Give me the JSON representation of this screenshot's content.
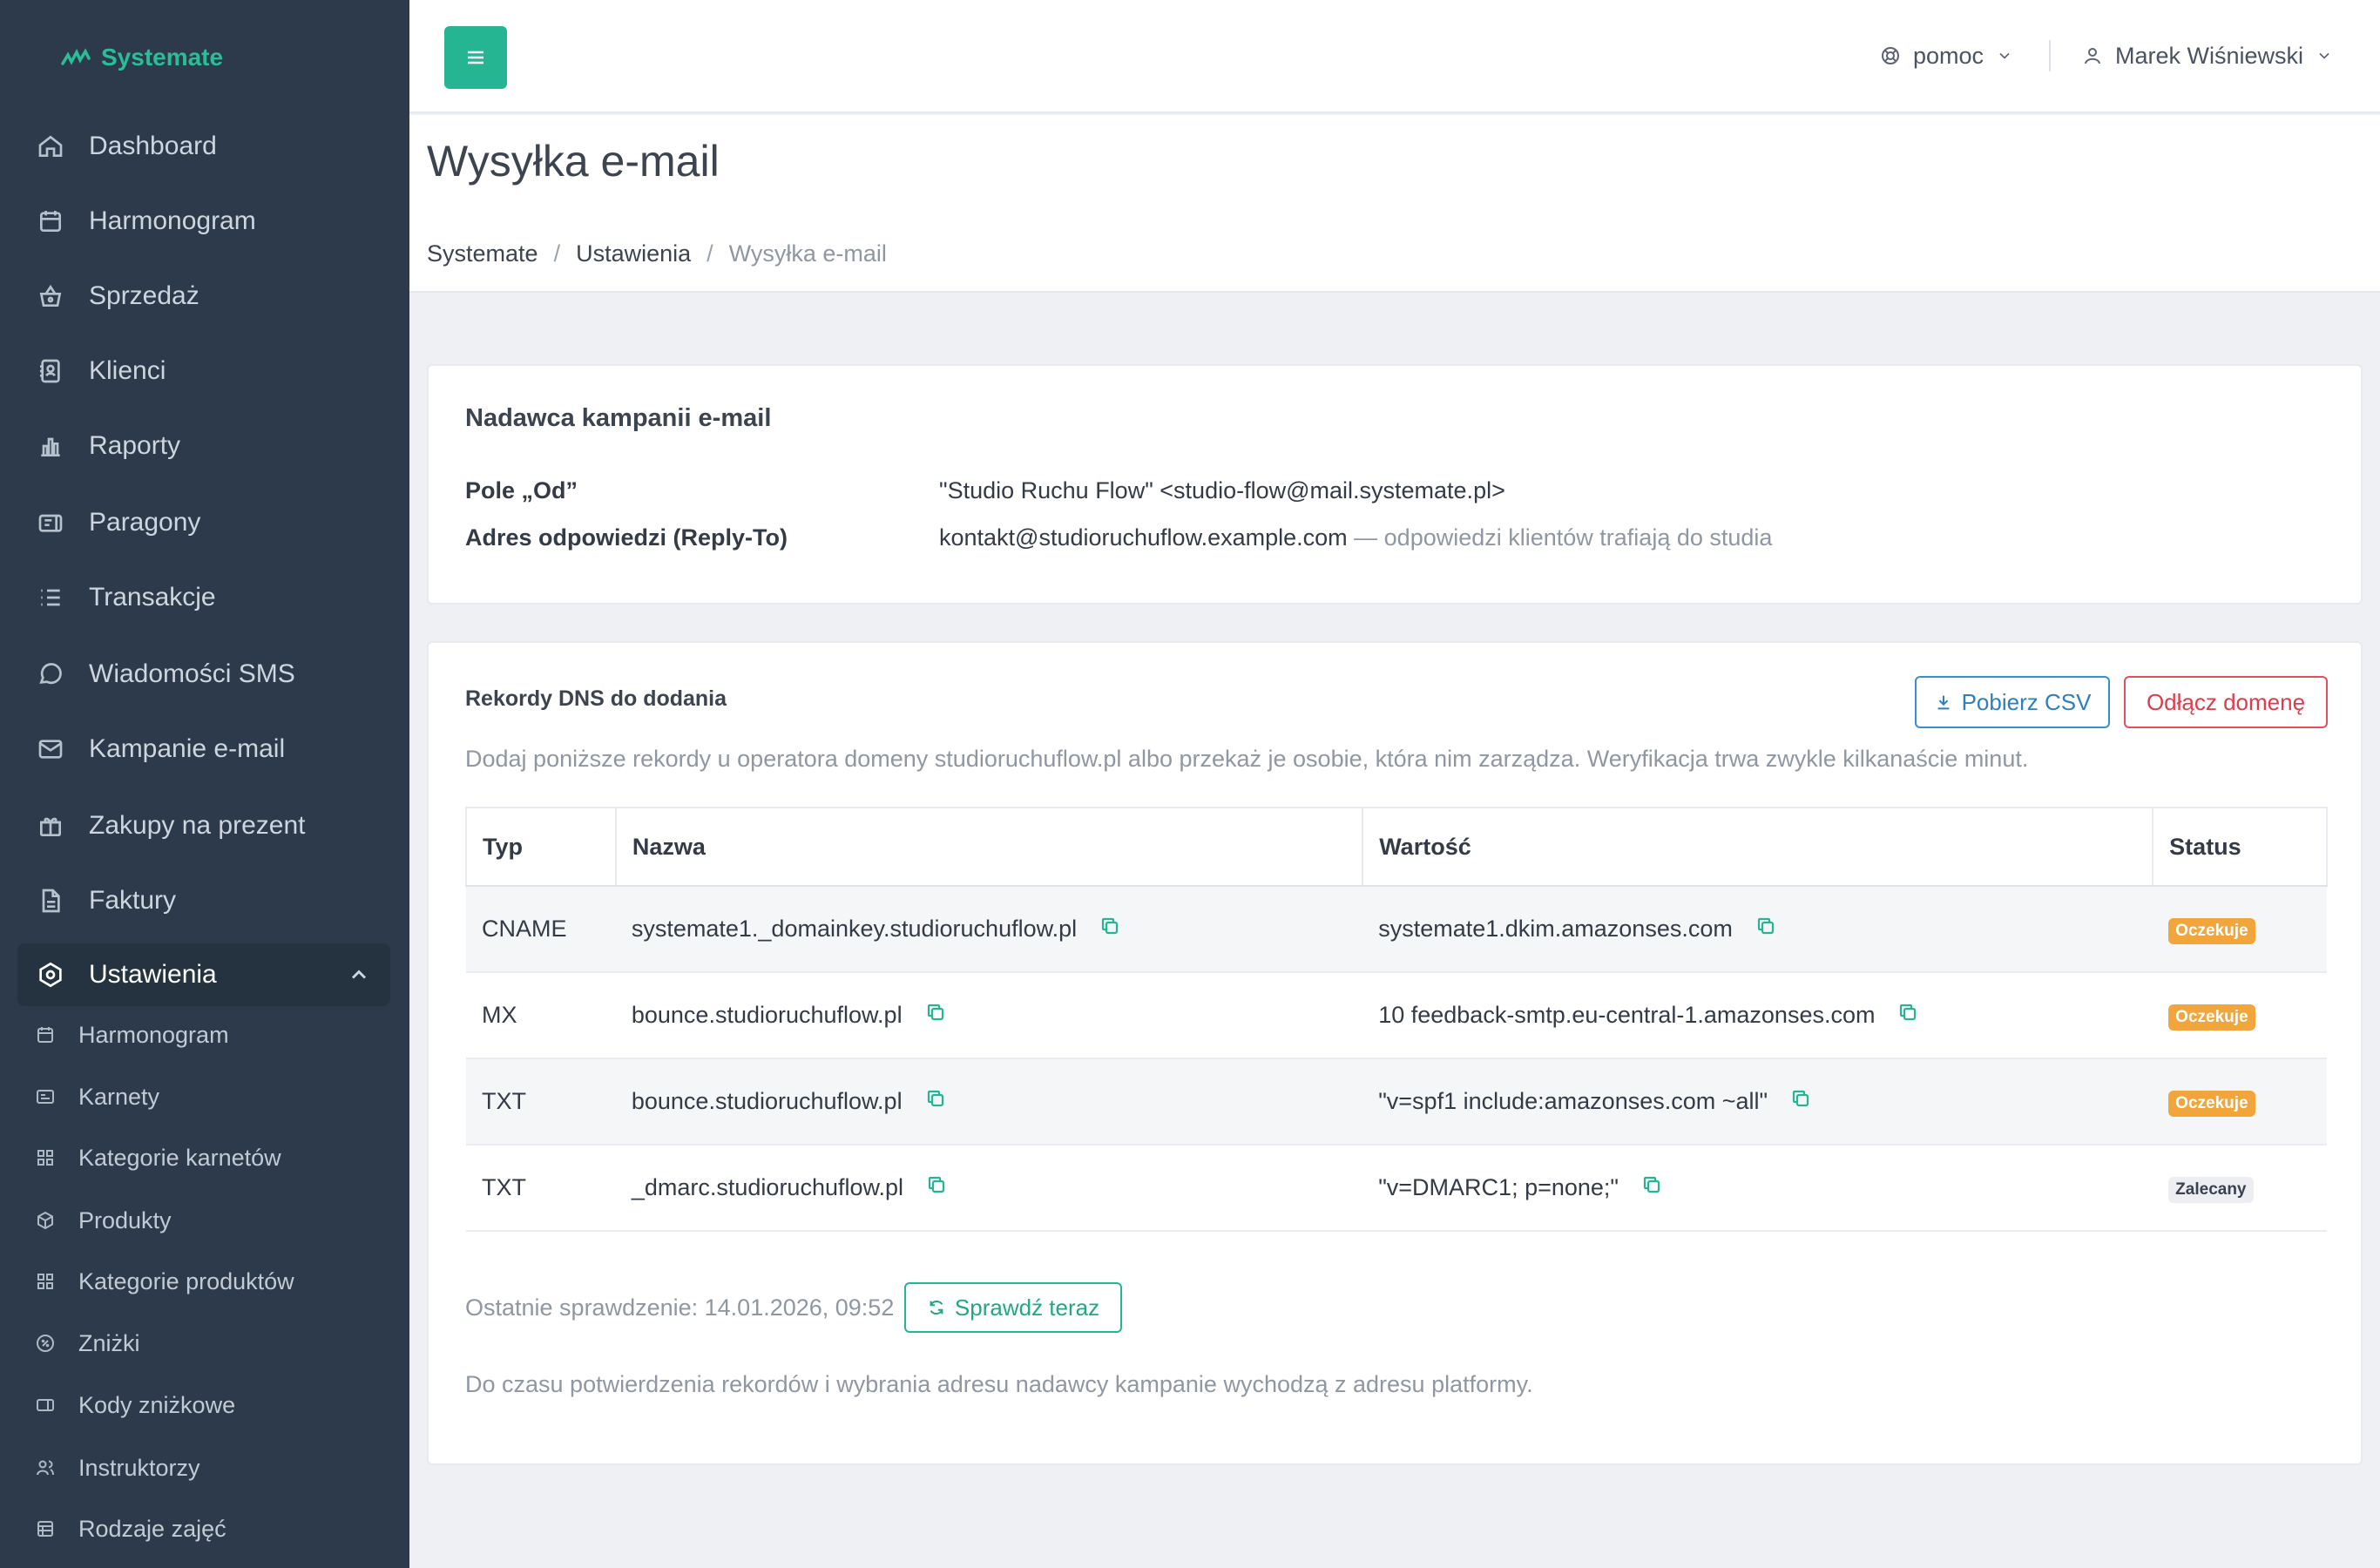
{
  "brand": {
    "name": "Systemate",
    "accent": "#25b593"
  },
  "sidebar": {
    "items": [
      {
        "label": "Dashboard",
        "icon": "home-icon"
      },
      {
        "label": "Harmonogram",
        "icon": "calendar-icon"
      },
      {
        "label": "Sprzedaż",
        "icon": "basket-icon"
      },
      {
        "label": "Klienci",
        "icon": "address-book-icon"
      },
      {
        "label": "Raporty",
        "icon": "bar-chart-icon"
      },
      {
        "label": "Paragony",
        "icon": "receipt-icon"
      },
      {
        "label": "Transakcje",
        "icon": "list-icon"
      },
      {
        "label": "Wiadomości SMS",
        "icon": "chat-icon"
      },
      {
        "label": "Kampanie e-mail",
        "icon": "mail-icon"
      },
      {
        "label": "Zakupy na prezent",
        "icon": "gift-icon"
      },
      {
        "label": "Faktury",
        "icon": "file-icon"
      },
      {
        "label": "Ustawienia",
        "icon": "settings-icon",
        "active": true
      }
    ],
    "subitems": [
      {
        "label": "Harmonogram",
        "icon": "calendar-icon"
      },
      {
        "label": "Karnety",
        "icon": "card-icon"
      },
      {
        "label": "Kategorie karnetów",
        "icon": "grid-icon"
      },
      {
        "label": "Produkty",
        "icon": "box-icon"
      },
      {
        "label": "Kategorie produktów",
        "icon": "grid-icon"
      },
      {
        "label": "Zniżki",
        "icon": "discount-icon"
      },
      {
        "label": "Kody zniżkowe",
        "icon": "ticket-icon"
      },
      {
        "label": "Instruktorzy",
        "icon": "users-icon"
      },
      {
        "label": "Rodzaje zajęć",
        "icon": "list-detail-icon"
      }
    ]
  },
  "topbar": {
    "menu_button": "≡",
    "help_label": "pomoc",
    "user_name": "Marek Wiśniewski"
  },
  "page": {
    "title": "Wysyłka e-mail",
    "breadcrumb": [
      "Systemate",
      "Ustawienia",
      "Wysyłka e-mail"
    ]
  },
  "sender": {
    "title": "Nadawca kampanii e-mail",
    "from_label": "Pole „Od”",
    "from_value": "\"Studio Ruchu Flow\" <studio-flow@mail.systemate.pl>",
    "reply_label": "Adres odpowiedzi (Reply-To)",
    "reply_value": "kontakt@studioruchuflow.example.com",
    "reply_note": "— odpowiedzi klientów trafiają do studia"
  },
  "dns": {
    "title": "Rekordy DNS do dodania",
    "download_label": "Pobierz CSV",
    "disconnect_label": "Odłącz domenę",
    "description": "Dodaj poniższe rekordy u operatora domeny studioruchuflow.pl albo przekaż je osobie, która nim zarządza. Weryfikacja trwa zwykle kilkanaście minut.",
    "columns": [
      "Typ",
      "Nazwa",
      "Wartość",
      "Status"
    ],
    "rows": [
      {
        "type": "CNAME",
        "name": "systemate1._domainkey.studioruchuflow.pl",
        "value": "systemate1.dkim.amazonses.com",
        "status": "Oczekuje",
        "status_color": "#f2a53a"
      },
      {
        "type": "MX",
        "name": "bounce.studioruchuflow.pl",
        "value": "10 feedback-smtp.eu-central-1.amazonses.com",
        "status": "Oczekuje",
        "status_color": "#f2a53a"
      },
      {
        "type": "TXT",
        "name": "bounce.studioruchuflow.pl",
        "value": "\"v=spf1 include:amazonses.com ~all\"",
        "status": "Oczekuje",
        "status_color": "#f2a53a"
      },
      {
        "type": "TXT",
        "name": "_dmarc.studioruchuflow.pl",
        "value": "\"v=DMARC1; p=none;\"",
        "status": "Zalecany",
        "status_color": "#eceef1"
      }
    ],
    "last_check": "Ostatnie sprawdzenie: 14.01.2026, 09:52",
    "check_label": "Sprawdź teraz",
    "footnote": "Do czasu potwierdzenia rekordów i wybrania adresu nadawcy kampanie wychodzą z adresu platformy."
  }
}
